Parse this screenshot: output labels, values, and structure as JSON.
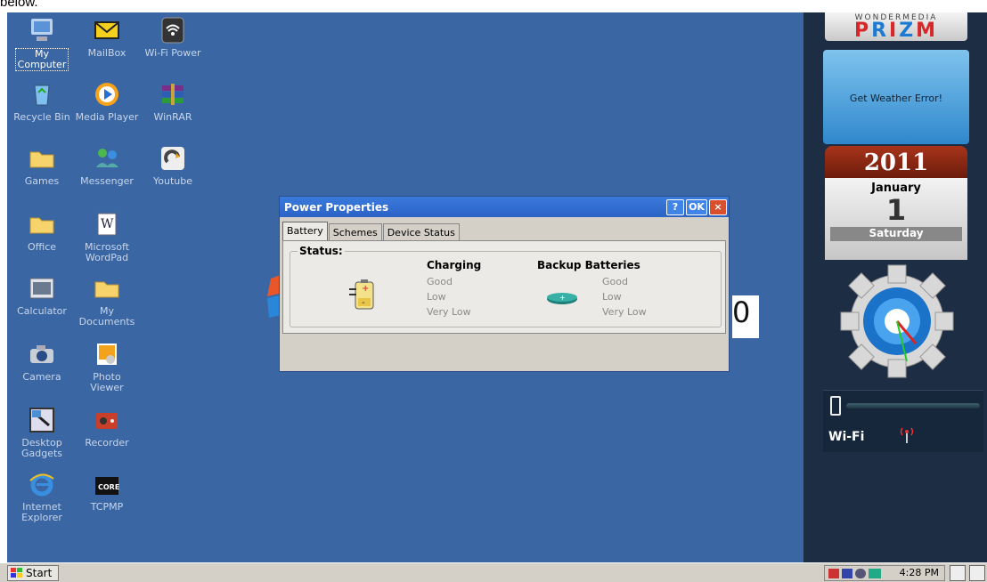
{
  "page_caption": "below.",
  "desktop_icons": [
    {
      "label": "My\nComputer",
      "icon": "computer-icon",
      "name": "my-computer"
    },
    {
      "label": "MailBox",
      "icon": "mail-icon",
      "name": "mailbox"
    },
    {
      "label": "Wi-Fi Power",
      "icon": "wifi-icon",
      "name": "wifi-power"
    },
    {
      "label": "Recycle Bin",
      "icon": "recycle-bin-icon",
      "name": "recycle-bin"
    },
    {
      "label": "Media Player",
      "icon": "media-player-icon",
      "name": "media-player"
    },
    {
      "label": "WinRAR",
      "icon": "archive-icon",
      "name": "winrar"
    },
    {
      "label": "Games",
      "icon": "folder-icon",
      "name": "games"
    },
    {
      "label": "Messenger",
      "icon": "messenger-icon",
      "name": "messenger"
    },
    {
      "label": "Youtube",
      "icon": "youtube-icon",
      "name": "youtube"
    },
    {
      "label": "Office",
      "icon": "folder-icon",
      "name": "office"
    },
    {
      "label": "Microsoft\nWordPad",
      "icon": "wordpad-icon",
      "name": "wordpad"
    },
    {
      "label": "Calculator",
      "icon": "calculator-icon",
      "name": "calculator"
    },
    {
      "label": "My\nDocuments",
      "icon": "folder-icon",
      "name": "my-documents"
    },
    {
      "label": "Camera",
      "icon": "camera-icon",
      "name": "camera"
    },
    {
      "label": "Photo\nViewer",
      "icon": "photo-viewer-icon",
      "name": "photo-viewer"
    },
    {
      "label": "Desktop\nGadgets",
      "icon": "gadgets-icon",
      "name": "desktop-gadgets"
    },
    {
      "label": "Recorder",
      "icon": "recorder-icon",
      "name": "recorder"
    },
    {
      "label": "Internet\nExplorer",
      "icon": "internet-explorer-icon",
      "name": "internet-explorer"
    },
    {
      "label": "TCPMP",
      "icon": "tcpmp-icon",
      "name": "tcpmp"
    }
  ],
  "background_digit": "0",
  "dialog": {
    "title": "Power Properties",
    "help_label": "?",
    "ok_label": "OK",
    "close_label": "×",
    "tabs": [
      "Battery",
      "Schemes",
      "Device Status"
    ],
    "active_tab": "Battery",
    "status_label": "Status:",
    "charging_heading": "Charging",
    "backup_heading": "Backup Batteries",
    "levels": [
      "Good",
      "Low",
      "Very Low"
    ]
  },
  "sidebar": {
    "brand_small": "WONDERMEDIA",
    "brand_big": "PRIZM",
    "weather_text": "Get Weather Error!",
    "year": "2011",
    "month": "January",
    "day": "1",
    "weekday": "Saturday",
    "wifi_label": "Wi-Fi"
  },
  "taskbar": {
    "start_label": "Start",
    "time": "4:28 PM"
  },
  "colors": {
    "desktop": "#3a66a3",
    "titlebar": "#2b62c6",
    "close_button": "#d9502f",
    "sidebar": "#1c2d44"
  }
}
